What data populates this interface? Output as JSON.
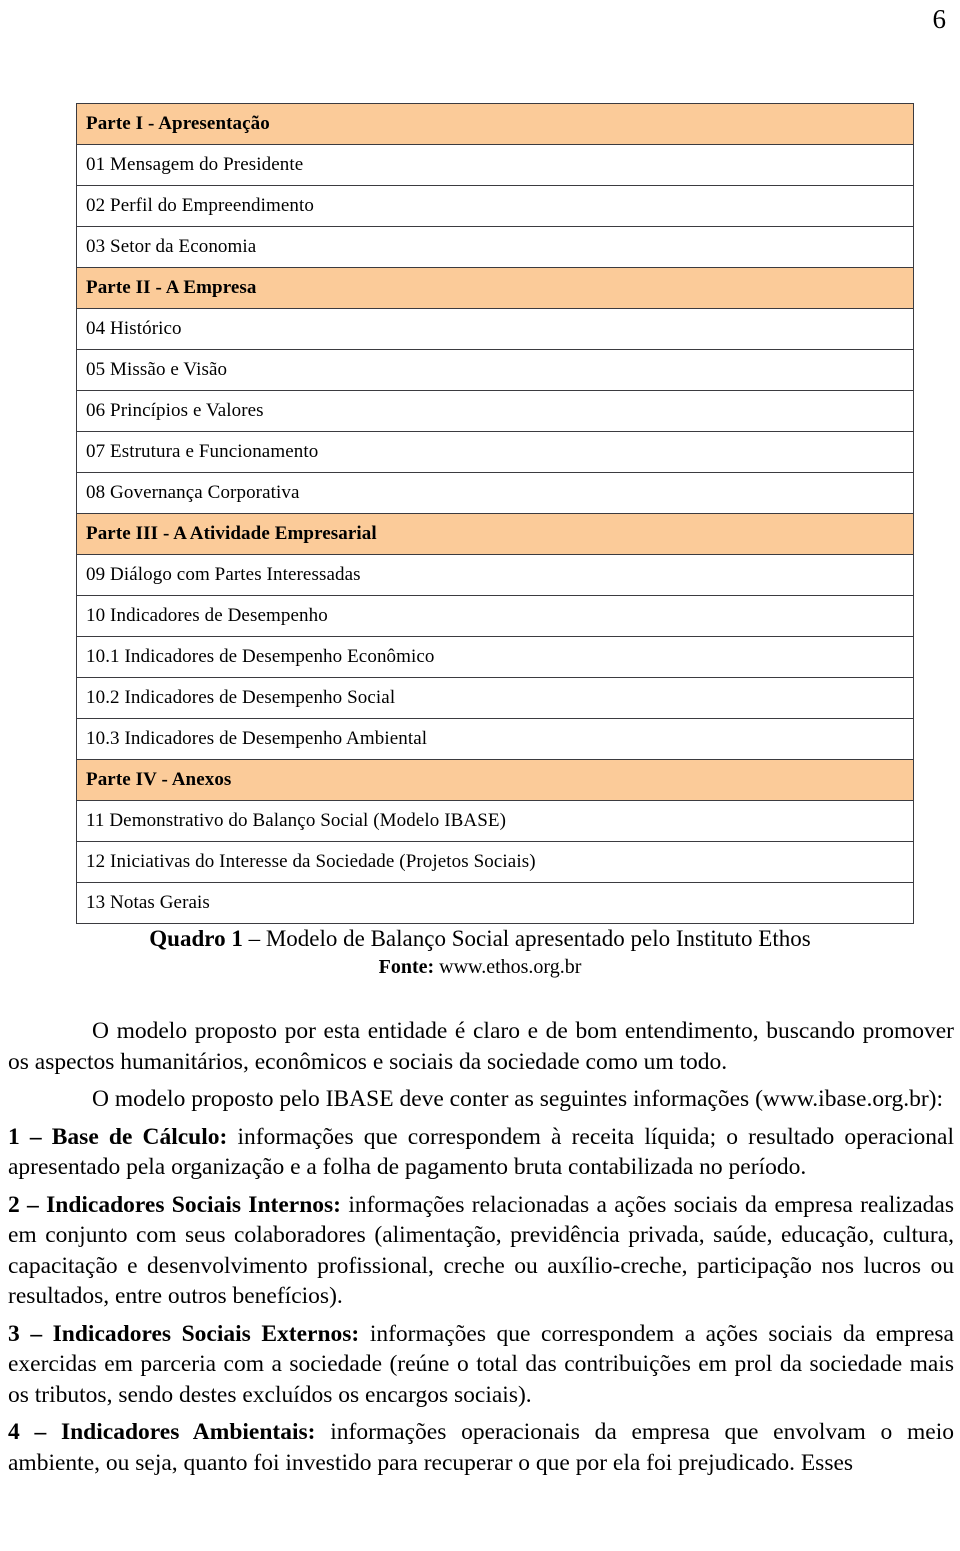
{
  "page": {
    "number": "6"
  },
  "toc": {
    "rows": [
      {
        "type": "part",
        "label": "Parte I - Apresentação"
      },
      {
        "type": "item",
        "label": "01 Mensagem do Presidente"
      },
      {
        "type": "item",
        "label": "02 Perfil do Empreendimento"
      },
      {
        "type": "item",
        "label": "03 Setor da Economia"
      },
      {
        "type": "part",
        "label": "Parte II - A Empresa"
      },
      {
        "type": "item",
        "label": "04 Histórico"
      },
      {
        "type": "item",
        "label": "05 Missão e Visão"
      },
      {
        "type": "item",
        "label": "06 Princípios e Valores"
      },
      {
        "type": "item",
        "label": "07 Estrutura e Funcionamento"
      },
      {
        "type": "item",
        "label": "08 Governança Corporativa"
      },
      {
        "type": "part",
        "label": "Parte III - A Atividade Empresarial"
      },
      {
        "type": "item",
        "label": "09 Diálogo com Partes Interessadas"
      },
      {
        "type": "item",
        "label": "10 Indicadores de Desempenho"
      },
      {
        "type": "item",
        "label": "10.1 Indicadores de Desempenho Econômico"
      },
      {
        "type": "item",
        "label": "10.2 Indicadores de Desempenho Social"
      },
      {
        "type": "item",
        "label": "10.3 Indicadores de Desempenho Ambiental"
      },
      {
        "type": "part",
        "label": "Parte IV - Anexos"
      },
      {
        "type": "item",
        "label": "11 Demonstrativo do Balanço Social (Modelo IBASE)"
      },
      {
        "type": "item",
        "label": "12 Iniciativas do Interesse da Sociedade (Projetos Sociais)"
      },
      {
        "type": "item",
        "label": "13 Notas Gerais"
      }
    ]
  },
  "caption": {
    "label": "Quadro 1",
    "text": " – Modelo de Balanço Social apresentado pelo Instituto Ethos",
    "source_label": "Fonte:",
    "source_value": " www.ethos.org.br"
  },
  "body": {
    "p1": "O modelo proposto por esta entidade é claro e de bom entendimento, buscando promover os aspectos humanitários, econômicos e sociais da sociedade como um todo.",
    "p2": "O modelo proposto pelo IBASE deve conter as seguintes informações (www.ibase.org.br):",
    "item1_head": "1 – Base de Cálculo:",
    "item1_body": " informações que correspondem à receita líquida; o resultado operacional apresentado pela organização e a folha de pagamento bruta contabilizada no período.",
    "item2_head": "2 – Indicadores Sociais Internos:",
    "item2_body": " informações relacionadas a ações sociais da empresa realizadas em conjunto com seus colaboradores (alimentação, previdência privada, saúde, educação, cultura, capacitação e desenvolvimento profissional, creche ou auxílio-creche, participação nos lucros ou resultados, entre outros benefícios).",
    "item3_head": "3 – Indicadores Sociais Externos:",
    "item3_body": " informações que correspondem a ações sociais da empresa exercidas em parceria com a sociedade (reúne o total das contribuições em prol da sociedade mais os tributos, sendo destes excluídos os encargos sociais).",
    "item4_head": "4 – Indicadores Ambientais:",
    "item4_body": " informações operacionais da empresa que envolvam o meio ambiente, ou seja, quanto foi investido para recuperar o que por ela foi prejudicado. Esses"
  },
  "colors": {
    "part_header_bg": "#fbcb99",
    "table_border": "#3b3b40",
    "text": "#000000"
  }
}
